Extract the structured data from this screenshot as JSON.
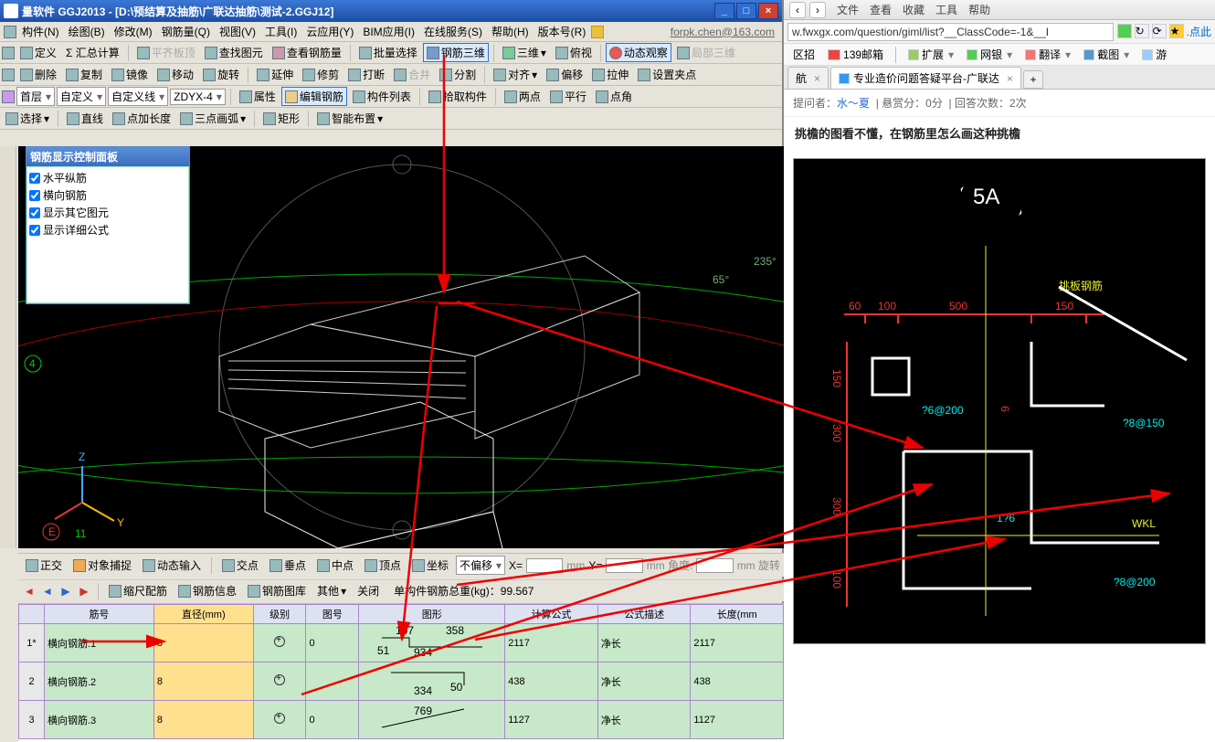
{
  "left": {
    "title": "量软件 GGJ2013 - [D:\\预结算及抽筋\\广联达抽筋\\测试-2.GGJ12]",
    "menus": [
      "构件(N)",
      "绘图(B)",
      "修改(M)",
      "钢筋量(Q)",
      "视图(V)",
      "工具(I)",
      "云应用(Y)",
      "BIM应用(I)",
      "在线服务(S)",
      "帮助(H)",
      "版本号(R)"
    ],
    "email": "forpk.chen@163.com",
    "tb1": {
      "define": "定义",
      "sum": "Σ 汇总计算",
      "flatplate": "平齐板顶",
      "findgrf": "查找图元",
      "viewsteel": "查看钢筋量",
      "batchsel": "批量选择",
      "steel3d": "钢筋三维",
      "view3d": "三维",
      "fushi": "俯视",
      "dynview": "动态观察",
      "local3d": "局部三维"
    },
    "tb2": {
      "del": "删除",
      "copy": "复制",
      "mirror": "镜像",
      "move": "移动",
      "rotate": "旋转",
      "extend": "延伸",
      "trim": "修剪",
      "break": "打断",
      "merge": "合并",
      "split": "分割",
      "align": "对齐",
      "offset": "偏移",
      "array": "拉伸",
      "setgrip": "设置夹点"
    },
    "tb3": {
      "layercombo": "首层",
      "custom": "自定义",
      "customline": "自定义线",
      "zdyx": "ZDYX-4",
      "prop": "属性",
      "editsteel": "编辑钢筋",
      "complist": "构件列表",
      "pickcomp": "拾取构件",
      "twopt": "两点",
      "parallel": "平行",
      "ptangle": "点角"
    },
    "tb4": {
      "select": "选择",
      "line": "直线",
      "ptlen": "点加长度",
      "arc3": "三点画弧",
      "rect": "矩形",
      "smartplace": "智能布置"
    },
    "panel": {
      "title": "钢筋显示控制面板",
      "items": [
        "水平纵筋",
        "横向钢筋",
        "显示其它图元",
        "显示详细公式"
      ]
    },
    "status": {
      "ortho": "正交",
      "objsnap": "对象捕捉",
      "dyninput": "动态输入",
      "intersect": "交点",
      "perp": "垂点",
      "mid": "中点",
      "endpt": "顶点",
      "coord": "坐标",
      "nooffset": "不偏移",
      "x": "X=",
      "y": "Y=",
      "ang": "mm 角度:",
      "rot": "mm 旋转"
    },
    "filebar": {
      "scalerib": "缩尺配筋",
      "steelinfo": "钢筋信息",
      "steellib": "钢筋图库",
      "other": "其他",
      "close": "关闭",
      "totalwt": "单构件钢筋总重(kg)：99.567"
    },
    "grid": {
      "headers": [
        "",
        "筋号",
        "直径(mm)",
        "级别",
        "图号",
        "图形",
        "计算公式",
        "公式描述",
        "长度(mm"
      ],
      "rows": [
        {
          "n": "1*",
          "name": "横向钢筋.1",
          "dia": "8",
          "lvl": "",
          "tuh": "0",
          "calc": "2117",
          "desc": "净长",
          "len": "2117",
          "dims": [
            "107",
            "358",
            "51",
            "934"
          ]
        },
        {
          "n": "2",
          "name": "横向钢筋.2",
          "dia": "8",
          "lvl": "",
          "tuh": "",
          "calc": "438",
          "desc": "净长",
          "len": "438",
          "dims": [
            "50",
            "334"
          ]
        },
        {
          "n": "3",
          "name": "横向钢筋.3",
          "dia": "8",
          "lvl": "",
          "tuh": "0",
          "calc": "1127",
          "desc": "净长",
          "len": "1127",
          "dims": [
            "769"
          ]
        }
      ]
    },
    "angles": {
      "a": "65°",
      "b": "235°"
    },
    "axis": {
      "z": "Z",
      "y": "Y"
    },
    "markers": {
      "four": "4",
      "e": "E",
      "eleven": "11"
    }
  },
  "right": {
    "topmenu": [
      "文件",
      "查看",
      "收藏",
      "工具",
      "帮助"
    ],
    "url": "w.fwxgx.com/question/giml/list?__ClassCode=-1&__I",
    "urltail": ".点此",
    "toolbar": {
      "zhaopin": "区招",
      "mailbox": "139邮箱",
      "ext": "扩展",
      "bank": "网银",
      "trans": "翻译",
      "shot": "截图",
      "game": "游"
    },
    "tabs": {
      "t1": "航",
      "t2": "专业造价问题答疑平台-广联达"
    },
    "meta": {
      "asker_l": "提问者：",
      "asker": "水～夏",
      "bounty": "悬赏分：0分",
      "answers": "回答次数：2次"
    },
    "qtitle": "挑檐的图看不懂，在钢筋里怎么画这种挑檐",
    "cad": {
      "node": "5A",
      "tbbar": "挑板钢筋",
      "d60": "60",
      "d100": "100",
      "d500": "500",
      "d150a": "150",
      "d150b": "150",
      "d300a": "300",
      "d300b": "300",
      "d100b": "100",
      "r6200": "?6@200",
      "r8150": "?8@150",
      "r176": "1?6",
      "r8200": "?8@200",
      "wkl": "WKL",
      "s6": "6"
    }
  }
}
